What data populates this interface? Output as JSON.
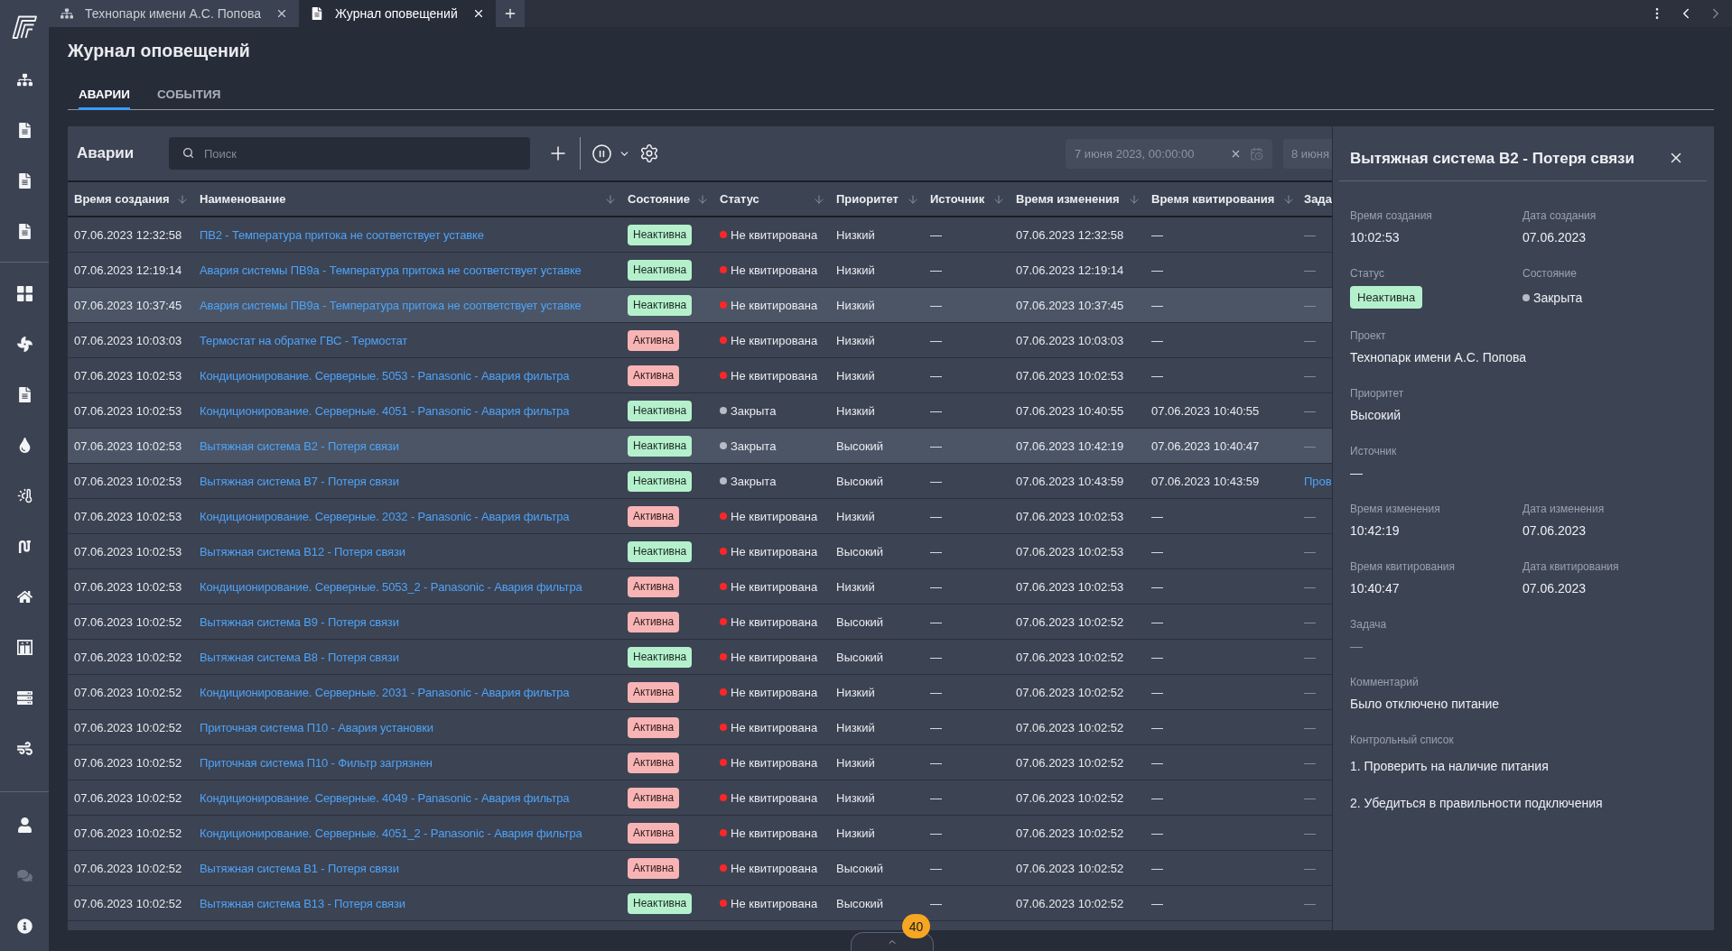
{
  "app_tabs": [
    {
      "label": "Технопарк имени А.С. Попова",
      "selected": false
    },
    {
      "label": "Журнал оповещений",
      "selected": true
    }
  ],
  "history_nav": {
    "back_disabled": false,
    "forward_disabled": true
  },
  "sidebar": {
    "groups": [
      [
        {
          "disabled": false
        },
        {
          "disabled": false
        },
        {
          "disabled": false
        },
        {
          "disabled": false
        }
      ],
      [
        {
          "disabled": false
        },
        {
          "disabled": false
        },
        {
          "disabled": false
        },
        {
          "disabled": false
        },
        {
          "disabled": false
        },
        {
          "disabled": false
        },
        {
          "disabled": false
        },
        {
          "disabled": false
        },
        {
          "disabled": false
        },
        {
          "disabled": false
        }
      ],
      [
        {
          "disabled": false
        },
        {
          "disabled": true
        },
        {
          "disabled": false
        }
      ]
    ]
  },
  "page": {
    "title": "Журнал оповещений",
    "tabs": [
      {
        "label": "АВАРИИ",
        "selected": true
      },
      {
        "label": "СОБЫТИЯ",
        "selected": false
      }
    ]
  },
  "table_panel": {
    "title": "Аварии",
    "search": {
      "placeholder": "Поиск"
    },
    "date_from": {
      "value": "7 июня 2023, 00:00:00",
      "disabled": true
    },
    "date_to": {
      "value": "8 июня",
      "disabled": true
    }
  },
  "table": {
    "columns": [
      {
        "label": "Время создания"
      },
      {
        "label": "Наименование"
      },
      {
        "label": "Состояние"
      },
      {
        "label": "Статус"
      },
      {
        "label": "Приоритет"
      },
      {
        "label": "Источник"
      },
      {
        "label": "Время изменения"
      },
      {
        "label": "Время квитирования"
      },
      {
        "label": "Зада"
      }
    ],
    "rows": [
      {
        "created": "07.06.2023 12:32:58",
        "name": "ПВ2 - Температура притока не соответствует уставке",
        "state": {
          "label": "Неактивна",
          "active": false
        },
        "status": {
          "label": "Не квитирована",
          "color": "#ff2626"
        },
        "priority": "Низкий",
        "source": "—",
        "changed": "07.06.2023 12:32:58",
        "acknowledged": "—",
        "task": {
          "label": "—",
          "link": false
        },
        "selected": false
      },
      {
        "created": "07.06.2023 12:19:14",
        "name": "Авария системы ПВ9а - Температура притока не соответствует уставке",
        "state": {
          "label": "Неактивна",
          "active": false
        },
        "status": {
          "label": "Не квитирована",
          "color": "#ff2626"
        },
        "priority": "Низкий",
        "source": "—",
        "changed": "07.06.2023 12:19:14",
        "acknowledged": "—",
        "task": {
          "label": "—",
          "link": false
        },
        "selected": false
      },
      {
        "created": "07.06.2023 10:37:45",
        "name": "Авария системы ПВ9а - Температура притока не соответствует уставке",
        "state": {
          "label": "Неактивна",
          "active": false
        },
        "status": {
          "label": "Не квитирована",
          "color": "#ff2626"
        },
        "priority": "Низкий",
        "source": "—",
        "changed": "07.06.2023 10:37:45",
        "acknowledged": "—",
        "task": {
          "label": "—",
          "link": false
        },
        "selected": true
      },
      {
        "created": "07.06.2023 10:03:03",
        "name": "Термостат на обратке ГВС - Термостат",
        "state": {
          "label": "Активна",
          "active": true
        },
        "status": {
          "label": "Не квитирована",
          "color": "#ff2626"
        },
        "priority": "Низкий",
        "source": "—",
        "changed": "07.06.2023 10:03:03",
        "acknowledged": "—",
        "task": {
          "label": "—",
          "link": false
        },
        "selected": false
      },
      {
        "created": "07.06.2023 10:02:53",
        "name": "Кондиционирование. Серверные. 5053 - Panasonic - Авария фильтра",
        "state": {
          "label": "Активна",
          "active": true
        },
        "status": {
          "label": "Не квитирована",
          "color": "#ff2626"
        },
        "priority": "Низкий",
        "source": "—",
        "changed": "07.06.2023 10:02:53",
        "acknowledged": "—",
        "task": {
          "label": "—",
          "link": false
        },
        "selected": false
      },
      {
        "created": "07.06.2023 10:02:53",
        "name": "Кондиционирование. Серверные. 4051 - Panasonic - Авария фильтра",
        "state": {
          "label": "Неактивна",
          "active": false
        },
        "status": {
          "label": "Закрыта",
          "color": "#b7bbc3"
        },
        "priority": "Низкий",
        "source": "—",
        "changed": "07.06.2023 10:40:55",
        "acknowledged": "07.06.2023 10:40:55",
        "task": {
          "label": "—",
          "link": false
        },
        "selected": false
      },
      {
        "created": "07.06.2023 10:02:53",
        "name": "Вытяжная система В2 - Потеря связи",
        "state": {
          "label": "Неактивна",
          "active": false
        },
        "status": {
          "label": "Закрыта",
          "color": "#b7bbc3"
        },
        "priority": "Высокий",
        "source": "—",
        "changed": "07.06.2023 10:42:19",
        "acknowledged": "07.06.2023 10:40:47",
        "task": {
          "label": "—",
          "link": false
        },
        "selected": true
      },
      {
        "created": "07.06.2023 10:02:53",
        "name": "Вытяжная система В7 - Потеря связи",
        "state": {
          "label": "Неактивна",
          "active": false
        },
        "status": {
          "label": "Закрыта",
          "color": "#b7bbc3"
        },
        "priority": "Высокий",
        "source": "—",
        "changed": "07.06.2023 10:43:59",
        "acknowledged": "07.06.2023 10:43:59",
        "task": {
          "label": "Пров",
          "link": true
        },
        "selected": false
      },
      {
        "created": "07.06.2023 10:02:53",
        "name": "Кондиционирование. Серверные. 2032 - Panasonic - Авария фильтра",
        "state": {
          "label": "Активна",
          "active": true
        },
        "status": {
          "label": "Не квитирована",
          "color": "#ff2626"
        },
        "priority": "Низкий",
        "source": "—",
        "changed": "07.06.2023 10:02:53",
        "acknowledged": "—",
        "task": {
          "label": "—",
          "link": false
        },
        "selected": false
      },
      {
        "created": "07.06.2023 10:02:53",
        "name": "Вытяжная система В12 - Потеря связи",
        "state": {
          "label": "Неактивна",
          "active": false
        },
        "status": {
          "label": "Не квитирована",
          "color": "#ff2626"
        },
        "priority": "Высокий",
        "source": "—",
        "changed": "07.06.2023 10:02:53",
        "acknowledged": "—",
        "task": {
          "label": "—",
          "link": false
        },
        "selected": false
      },
      {
        "created": "07.06.2023 10:02:53",
        "name": "Кондиционирование. Серверные. 5053_2 - Panasonic - Авария фильтра",
        "state": {
          "label": "Активна",
          "active": true
        },
        "status": {
          "label": "Не квитирована",
          "color": "#ff2626"
        },
        "priority": "Низкий",
        "source": "—",
        "changed": "07.06.2023 10:02:53",
        "acknowledged": "—",
        "task": {
          "label": "—",
          "link": false
        },
        "selected": false
      },
      {
        "created": "07.06.2023 10:02:52",
        "name": "Вытяжная система В9 - Потеря связи",
        "state": {
          "label": "Активна",
          "active": true
        },
        "status": {
          "label": "Не квитирована",
          "color": "#ff2626"
        },
        "priority": "Высокий",
        "source": "—",
        "changed": "07.06.2023 10:02:52",
        "acknowledged": "—",
        "task": {
          "label": "—",
          "link": false
        },
        "selected": false
      },
      {
        "created": "07.06.2023 10:02:52",
        "name": "Вытяжная система В8 - Потеря связи",
        "state": {
          "label": "Неактивна",
          "active": false
        },
        "status": {
          "label": "Не квитирована",
          "color": "#ff2626"
        },
        "priority": "Высокий",
        "source": "—",
        "changed": "07.06.2023 10:02:52",
        "acknowledged": "—",
        "task": {
          "label": "—",
          "link": false
        },
        "selected": false
      },
      {
        "created": "07.06.2023 10:02:52",
        "name": "Кондиционирование. Серверные. 2031 - Panasonic - Авария фильтра",
        "state": {
          "label": "Активна",
          "active": true
        },
        "status": {
          "label": "Не квитирована",
          "color": "#ff2626"
        },
        "priority": "Низкий",
        "source": "—",
        "changed": "07.06.2023 10:02:52",
        "acknowledged": "—",
        "task": {
          "label": "—",
          "link": false
        },
        "selected": false
      },
      {
        "created": "07.06.2023 10:02:52",
        "name": "Приточная система П10 - Авария установки",
        "state": {
          "label": "Активна",
          "active": true
        },
        "status": {
          "label": "Не квитирована",
          "color": "#ff2626"
        },
        "priority": "Низкий",
        "source": "—",
        "changed": "07.06.2023 10:02:52",
        "acknowledged": "—",
        "task": {
          "label": "—",
          "link": false
        },
        "selected": false
      },
      {
        "created": "07.06.2023 10:02:52",
        "name": "Приточная система П10 - Фильтр загрязнен",
        "state": {
          "label": "Активна",
          "active": true
        },
        "status": {
          "label": "Не квитирована",
          "color": "#ff2626"
        },
        "priority": "Низкий",
        "source": "—",
        "changed": "07.06.2023 10:02:52",
        "acknowledged": "—",
        "task": {
          "label": "—",
          "link": false
        },
        "selected": false
      },
      {
        "created": "07.06.2023 10:02:52",
        "name": "Кондиционирование. Серверные. 4049 - Panasonic - Авария фильтра",
        "state": {
          "label": "Активна",
          "active": true
        },
        "status": {
          "label": "Не квитирована",
          "color": "#ff2626"
        },
        "priority": "Низкий",
        "source": "—",
        "changed": "07.06.2023 10:02:52",
        "acknowledged": "—",
        "task": {
          "label": "—",
          "link": false
        },
        "selected": false
      },
      {
        "created": "07.06.2023 10:02:52",
        "name": "Кондиционирование. Серверные. 4051_2 - Panasonic - Авария фильтра",
        "state": {
          "label": "Активна",
          "active": true
        },
        "status": {
          "label": "Не квитирована",
          "color": "#ff2626"
        },
        "priority": "Низкий",
        "source": "—",
        "changed": "07.06.2023 10:02:52",
        "acknowledged": "—",
        "task": {
          "label": "—",
          "link": false
        },
        "selected": false
      },
      {
        "created": "07.06.2023 10:02:52",
        "name": "Вытяжная система В1 - Потеря связи",
        "state": {
          "label": "Активна",
          "active": true
        },
        "status": {
          "label": "Не квитирована",
          "color": "#ff2626"
        },
        "priority": "Высокий",
        "source": "—",
        "changed": "07.06.2023 10:02:52",
        "acknowledged": "—",
        "task": {
          "label": "—",
          "link": false
        },
        "selected": false
      },
      {
        "created": "07.06.2023 10:02:52",
        "name": "Вытяжная система В13 - Потеря связи",
        "state": {
          "label": "Неактивна",
          "active": false
        },
        "status": {
          "label": "Не квитирована",
          "color": "#ff2626"
        },
        "priority": "Высокий",
        "source": "—",
        "changed": "07.06.2023 10:02:52",
        "acknowledged": "—",
        "task": {
          "label": "—",
          "link": false
        },
        "selected": false
      }
    ]
  },
  "notifications": {
    "count": "40"
  },
  "detail": {
    "title": "Вытяжная система В2 - Потеря связи",
    "rows": [
      [
        {
          "kind": "text",
          "label": "Время создания",
          "value": "10:02:53",
          "muted": false
        },
        {
          "kind": "text",
          "label": "Дата создания",
          "value": "07.06.2023",
          "muted": false
        }
      ],
      [
        {
          "kind": "badge",
          "label": "Статус",
          "value": "Неактивна",
          "active": false
        },
        {
          "kind": "dot",
          "label": "Состояние",
          "value": "Закрыта",
          "color": "#b7bbc3"
        }
      ],
      [
        {
          "kind": "text",
          "label": "Проект",
          "value": "Технопарк имени А.С. Попова",
          "muted": false
        }
      ],
      [
        {
          "kind": "text",
          "label": "Приоритет",
          "value": "Высокий",
          "muted": false
        }
      ],
      [
        {
          "kind": "text",
          "label": "Источник",
          "value": "—",
          "muted": false
        }
      ],
      [
        {
          "kind": "text",
          "label": "Время изменения",
          "value": "10:42:19",
          "muted": false
        },
        {
          "kind": "text",
          "label": "Дата изменения",
          "value": "07.06.2023",
          "muted": false
        }
      ],
      [
        {
          "kind": "text",
          "label": "Время квитирования",
          "value": "10:40:47",
          "muted": false
        },
        {
          "kind": "text",
          "label": "Дата квитирования",
          "value": "07.06.2023",
          "muted": false
        }
      ],
      [
        {
          "kind": "text",
          "label": "Задача",
          "value": "—",
          "muted": true
        }
      ],
      [
        {
          "kind": "text",
          "label": "Комментарий",
          "value": "Было отключено питание",
          "muted": false
        }
      ],
      [
        {
          "kind": "list",
          "label": "Контрольный список",
          "items": [
            "1. Проверить на наличие питания",
            "2. Убедиться в правильности подключения"
          ]
        }
      ]
    ]
  }
}
